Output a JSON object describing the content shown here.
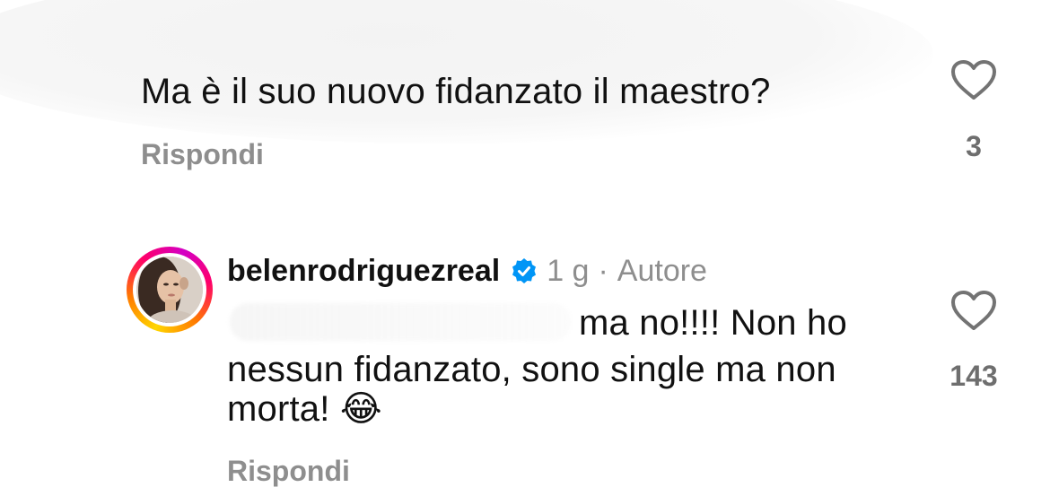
{
  "comment1": {
    "text": "Ma è il suo nuovo fidanzato il maestro?",
    "reply_label": "Rispondi",
    "like_count": "3",
    "icon": "heart-outline-icon"
  },
  "comment2": {
    "username": "belenrodriguezreal",
    "verified_icon": "verified-badge-icon",
    "time": "1 g",
    "separator": "·",
    "role": "Autore",
    "text_line1": "ma no!!!! Non ho",
    "text_line2": "nessun fidanzato, sono single ma non",
    "text_line3": "morta!",
    "emoji": "😂",
    "reply_label": "Rispondi",
    "like_count": "143",
    "icon": "heart-outline-icon"
  },
  "colors": {
    "text": "#111111",
    "secondary": "#8e8e8e",
    "verified_blue": "#0095f6"
  }
}
